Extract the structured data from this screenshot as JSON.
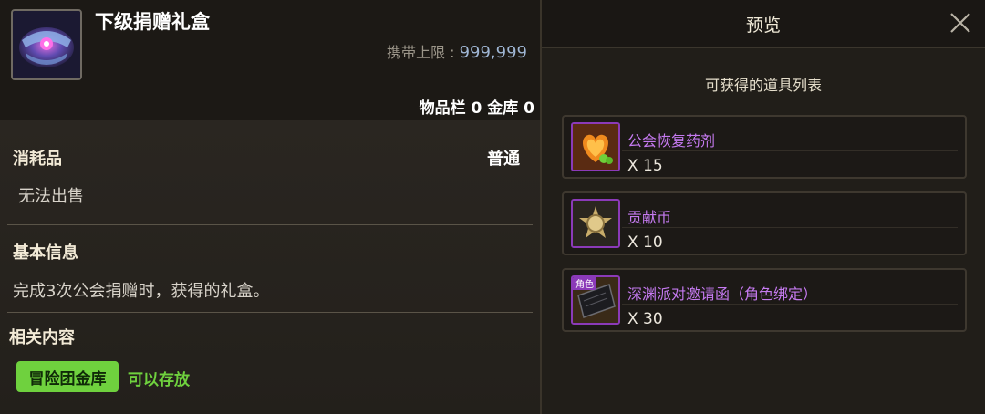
{
  "item": {
    "title": "下级捐赠礼盒",
    "carry_limit_label": "携带上限 : ",
    "carry_limit_value": "999,999",
    "inventory_text": "物品栏 0 金库 0",
    "category": "消耗品",
    "grade": "普通",
    "sell_status": "无法出售",
    "basic_info_title": "基本信息",
    "basic_info_text": "完成3次公会捐赠时，获得的礼盒。",
    "related_title": "相关内容",
    "related_tag": "冒险团金库",
    "related_status": "可以存放"
  },
  "preview": {
    "title": "预览",
    "list_caption": "可获得的道具列表",
    "rewards": [
      {
        "name": "公会恢复药剂",
        "qty": "X 15",
        "icon": "guild-potion-icon"
      },
      {
        "name": "贡献币",
        "qty": "X 10",
        "icon": "contribution-coin-icon"
      },
      {
        "name": "深渊派对邀请函（角色绑定）",
        "qty": "X 30",
        "icon": "abyss-invitation-icon",
        "badge": "角色"
      }
    ]
  },
  "colors": {
    "accent_purple": "#c57af0",
    "accent_green": "#6fd13e",
    "limit_blue": "#9fb6d4"
  }
}
